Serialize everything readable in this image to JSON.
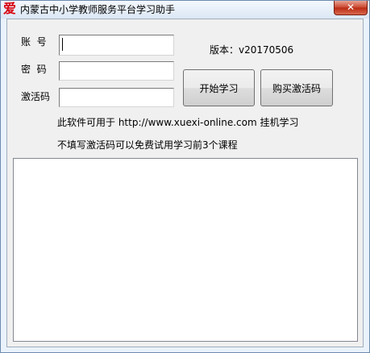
{
  "window": {
    "title": "内蒙古中小学教师服务平台学习助手",
    "icon_glyph": "爱",
    "close_glyph": "✕"
  },
  "login": {
    "account_label": "账  号",
    "password_label": "密  码",
    "activation_label": "激活码",
    "account_value": "",
    "password_value": "",
    "activation_value": ""
  },
  "version_text": "版本：v20170506",
  "buttons": {
    "start_label": "开始学习",
    "buy_label": "购买激活码"
  },
  "info": {
    "line1": "此软件可用于 http://www.xuexi-online.com 挂机学习",
    "line2": "不填写激活码可以免费试用学习前3个课程"
  },
  "log": {
    "content": ""
  }
}
